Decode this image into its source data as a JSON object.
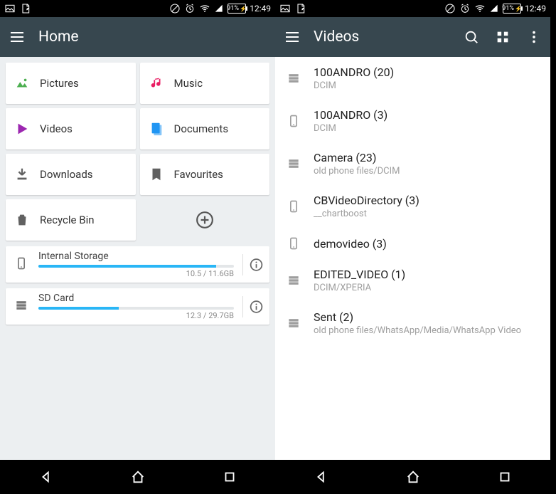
{
  "status": {
    "battery": "91%",
    "time": "12:49"
  },
  "left": {
    "title": "Home",
    "tiles": [
      {
        "label": "Pictures",
        "icon": "image",
        "color": "#4caf50"
      },
      {
        "label": "Music",
        "icon": "music",
        "color": "#e91e63"
      },
      {
        "label": "Videos",
        "icon": "play",
        "color": "#9c27b0"
      },
      {
        "label": "Documents",
        "icon": "doc",
        "color": "#2196f3"
      },
      {
        "label": "Downloads",
        "icon": "download",
        "color": "#616161"
      },
      {
        "label": "Favourites",
        "icon": "bookmark",
        "color": "#616161"
      },
      {
        "label": "Recycle Bin",
        "icon": "trash",
        "color": "#616161"
      }
    ],
    "storage": [
      {
        "name": "Internal Storage",
        "icon": "phone",
        "used": 10.5,
        "total": 11.6,
        "capacity": "10.5 / 11.6GB"
      },
      {
        "name": "SD Card",
        "icon": "storage",
        "used": 12.3,
        "total": 29.7,
        "capacity": "12.3 / 29.7GB"
      }
    ]
  },
  "right": {
    "title": "Videos",
    "items": [
      {
        "icon": "storage",
        "title": "100ANDRO (20)",
        "sub": "DCIM"
      },
      {
        "icon": "phone",
        "title": "100ANDRO (3)",
        "sub": "DCIM"
      },
      {
        "icon": "storage",
        "title": "Camera (23)",
        "sub": "old phone files/DCIM"
      },
      {
        "icon": "phone",
        "title": "CBVideoDirectory (3)",
        "sub": "__chartboost"
      },
      {
        "icon": "phone",
        "title": "demovideo (3)",
        "sub": ""
      },
      {
        "icon": "storage",
        "title": "EDITED_VIDEO (1)",
        "sub": "DCIM/XPERIA"
      },
      {
        "icon": "storage",
        "title": "Sent (2)",
        "sub": "old phone files/WhatsApp/Media/WhatsApp Video"
      }
    ]
  }
}
